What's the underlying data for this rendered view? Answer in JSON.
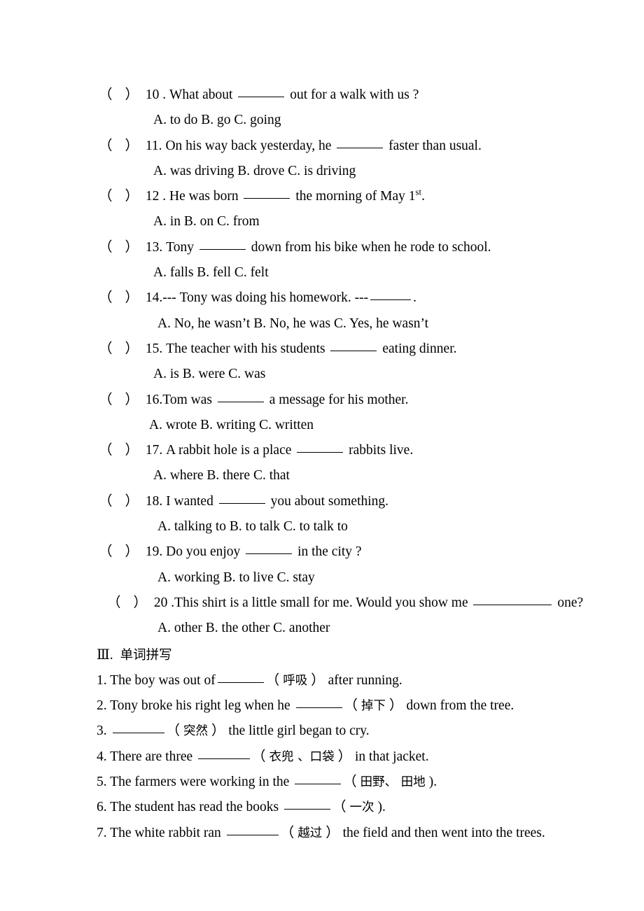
{
  "document": {
    "background_color": "#ffffff",
    "text_color": "#000000"
  },
  "multiple_choice": {
    "questions": [
      {
        "marker_open": "（",
        "marker_close": "）",
        "number": "10 .",
        "stem_before": "What about",
        "stem_after": "out for a walk with us ?",
        "blank": "w-lg",
        "options": "A. to do        B. go    C. going"
      },
      {
        "marker_open": "（",
        "marker_close": "）",
        "number": "11.",
        "stem_before": "On his way back yesterday, he",
        "stem_after": "faster than usual.",
        "blank": "w-lg",
        "options": "A. was driving     B. drove        C. is driving"
      },
      {
        "marker_open": "（",
        "marker_close": "）",
        "number": "12 .",
        "stem_before": "He was born",
        "stem_after": "the morning of May 1",
        "stem_sup": "st",
        "stem_tail": ".",
        "blank": "w-lg",
        "options": "A. in     B. on         C. from"
      },
      {
        "marker_open": "（",
        "marker_close": "）",
        "number": "13.",
        "stem_before": "Tony",
        "stem_after": "down from his bike when he rode to school.",
        "blank": "w-lg",
        "options": "A. falls      B. fell     C. felt"
      },
      {
        "marker_open": "（",
        "marker_close": "）",
        "number": "14.",
        "stem_before": "--- Tony was doing his homework. ---",
        "stem_after": ".",
        "blank": "w-md",
        "options": "A. No, he wasn’t      B. No, he was       C. Yes, he wasn’t"
      },
      {
        "marker_open": "（",
        "marker_close": "）",
        "number": "15.",
        "stem_before": "The teacher with his students",
        "stem_after": "eating dinner.",
        "blank": "w-lg",
        "options": "A. is         B. were      C. was"
      },
      {
        "marker_open": "（",
        "marker_close": "）",
        "number": "16.",
        "stem_before": "Tom was",
        "stem_after": "a message for his mother.",
        "blank": "w-lg",
        "no_space_after_number": true,
        "options": "A. wrote      B. writing    C. written"
      },
      {
        "marker_open": "（",
        "marker_close": "）",
        "number": "17.",
        "stem_before": "A rabbit hole is a place",
        "stem_after": "rabbits live.",
        "blank": "w-lg",
        "options": "A. where     B. there     C. that"
      },
      {
        "marker_open": "（",
        "marker_close": "）",
        "number": "18.",
        "stem_before": "I wanted",
        "stem_after": "you about something.",
        "blank": "w-lg",
        "options": "A. talking to     B. to talk     C. to talk to"
      },
      {
        "marker_open": "（",
        "marker_close": "）",
        "number": "19.",
        "stem_before": "Do you enjoy",
        "stem_after": "in the city ?",
        "blank": "w-lg",
        "options": "A. working     B. to live     C. stay"
      },
      {
        "marker_open": "（",
        "marker_close": "）",
        "number": "20 .",
        "stem_before": "This shirt is a little small for me. Would you show me",
        "stem_after": "one?",
        "blank": "w-xxl",
        "no_space_after_number": true,
        "extra_indent": true,
        "options": "A. other          B. the other             C. another"
      }
    ]
  },
  "spelling_section": {
    "heading_numeral": "Ⅲ.",
    "heading_title": "单词拼写",
    "items": [
      {
        "number": "1.",
        "before": "The boy was out of",
        "hint": "呼吸",
        "after": "after running.",
        "blank": "w-lg"
      },
      {
        "number": "2.",
        "before": "Tony broke his right leg when he",
        "hint": "掉下",
        "after": "down from the tree.",
        "blank": "w-lg"
      },
      {
        "number": "3.",
        "before": "",
        "hint": "突然",
        "after": "the little girl began to cry.",
        "blank": "w-xl"
      },
      {
        "number": "4.",
        "before": "There are three",
        "hint": "衣兜 、口袋",
        "after": "in that jacket.",
        "blank": "w-xl"
      },
      {
        "number": "5.",
        "before": "The farmers were working in the",
        "hint": "田野、 田地",
        "after": ").",
        "after_is_close_only": true,
        "blank": "w-lg"
      },
      {
        "number": "6.",
        "before": "The student has read the books",
        "hint": "一次",
        "after": ").",
        "after_is_close_only": true,
        "blank": "w-lg"
      },
      {
        "number": "7.",
        "before": "The white rabbit ran",
        "hint": "越过",
        "after": "the field and then went into the trees.",
        "blank": "w-xl"
      }
    ]
  }
}
